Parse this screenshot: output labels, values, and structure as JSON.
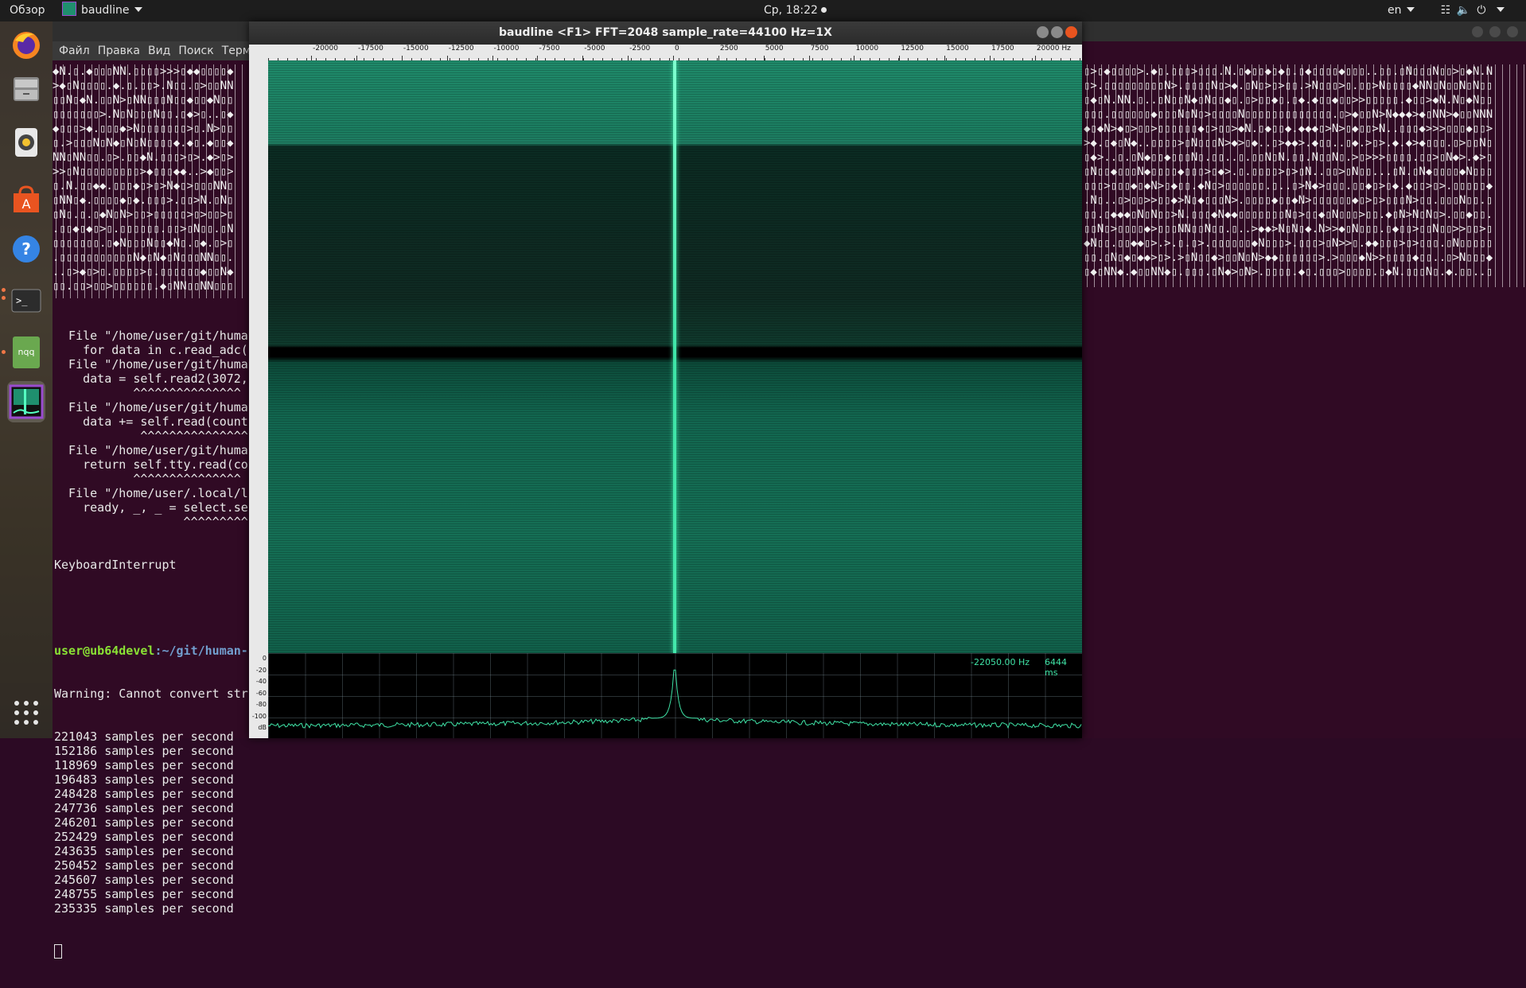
{
  "topbar": {
    "activities": "Обзор",
    "app_name": "baudline",
    "clock": "Ср, 18:22",
    "language": "en"
  },
  "dock": {
    "items": [
      {
        "name": "firefox-icon"
      },
      {
        "name": "files-icon"
      },
      {
        "name": "rhythmbox-icon"
      },
      {
        "name": "software-icon"
      },
      {
        "name": "help-icon"
      },
      {
        "name": "terminal-icon"
      },
      {
        "name": "nqq-icon",
        "label": "nqq"
      },
      {
        "name": "baudline-icon"
      },
      {
        "name": "app-grid-icon"
      }
    ]
  },
  "terminal": {
    "menu": [
      "Файл",
      "Правка",
      "Вид",
      "Поиск",
      "Терм"
    ],
    "traceback": [
      "  File \"/home/user/git/huma",
      "    for data in c.read_adc(",
      "  File \"/home/user/git/huma",
      "    data = self.read2(3072,",
      "           ^^^^^^^^^^^^^^^",
      "  File \"/home/user/git/huma",
      "    data += self.read(count",
      "            ^^^^^^^^^^^^^^^",
      "  File \"/home/user/git/huma",
      "    return self.tty.read(co",
      "           ^^^^^^^^^^^^^^^",
      "  File \"/home/user/.local/l",
      "    ready, _, _ = select.se",
      "                  ^^^^^^^^^"
    ],
    "interrupt": "KeyboardInterrupt",
    "prompt_user": "user@ub64devel",
    "prompt_path": ":~/git/human-",
    "warning": "Warning: Cannot convert str",
    "samples": [
      "221043 samples per second",
      "152186 samples per second",
      "118969 samples per second",
      "196483 samples per second",
      "248428 samples per second",
      "247736 samples per second",
      "246201 samples per second",
      "252429 samples per second",
      "243635 samples per second",
      "250452 samples per second",
      "245607 samples per second",
      "248755 samples per second",
      "235335 samples per second"
    ]
  },
  "baudline": {
    "title": "baudline  <F1> FFT=2048 sample_rate=44100 Hz=1X",
    "freq_ticks": [
      "-20000",
      "-17500",
      "-15000",
      "-12500",
      "-10000",
      "-7500",
      "-5000",
      "-2500",
      "0",
      "2500",
      "5000",
      "7500",
      "10000",
      "12500",
      "15000",
      "17500",
      "20000 Hz"
    ],
    "time_unit": "ms",
    "db_ticks": [
      "0",
      "-20",
      "-40",
      "-60",
      "-80",
      "-100",
      "dB"
    ],
    "readout_freq": "-22050.00 Hz",
    "readout_time": "6444 ms",
    "colors": {
      "trace": "#3fe3a6",
      "waterfall": "#1b7d60"
    }
  }
}
